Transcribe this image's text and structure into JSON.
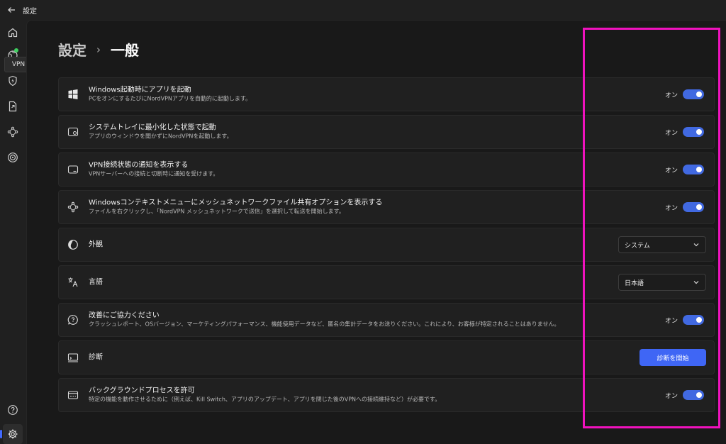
{
  "window": {
    "title": "設定"
  },
  "rail": {
    "tooltip": "VPN",
    "icons": [
      "home-icon",
      "globe-icon",
      "shield-bolt-icon",
      "file-share-icon",
      "meshnet-icon",
      "target-icon",
      "help-icon",
      "settings-icon"
    ]
  },
  "breadcrumb": {
    "root": "設定",
    "separator": "›",
    "current": "一般"
  },
  "settings": [
    {
      "title": "Windows起動時にアプリを起動",
      "desc": "PCをオンにするたびにNordVPNアプリを自動的に起動します。",
      "control": "toggle",
      "state_label": "オン",
      "on": true
    },
    {
      "title": "システムトレイに最小化した状態で起動",
      "desc": "アプリのウィンドウを開かずにNordVPNを起動します。",
      "control": "toggle",
      "state_label": "オン",
      "on": true
    },
    {
      "title": "VPN接続状態の通知を表示する",
      "desc": "VPNサーバーへの接続と切断時に通知を受けます。",
      "control": "toggle",
      "state_label": "オン",
      "on": true
    },
    {
      "title": "Windowsコンテキストメニューにメッシュネットワークファイル共有オプションを表示する",
      "desc": "ファイルを右クリックし、「NordVPN メッシュネットワークで送信」を選択して転送を開始します。",
      "control": "toggle",
      "state_label": "オン",
      "on": true
    },
    {
      "title": "外観",
      "control": "select",
      "value": "システム"
    },
    {
      "title": "言語",
      "control": "select",
      "value": "日本語"
    },
    {
      "title": "改善にご協力ください",
      "desc": "クラッシュレポート、OSバージョン、マーケティングパフォーマンス、機能使用データなど、匿名の集計データをお送りください。これにより、お客様が特定されることはありません。",
      "control": "toggle",
      "state_label": "オン",
      "on": true
    },
    {
      "title": "診断",
      "control": "button",
      "button_label": "診断を開始"
    },
    {
      "title": "バックグラウンドプロセスを許可",
      "desc": "特定の機能を動作させるために（例えば、Kill Switch、アプリのアップデート、アプリを閉じた後のVPNへの接続維持など）が必要です。",
      "control": "toggle",
      "state_label": "オン",
      "on": true
    }
  ],
  "colors": {
    "accent": "#4169e1",
    "button": "#3f66f5",
    "highlight": "#f012be",
    "connected": "#3ecf5f"
  }
}
